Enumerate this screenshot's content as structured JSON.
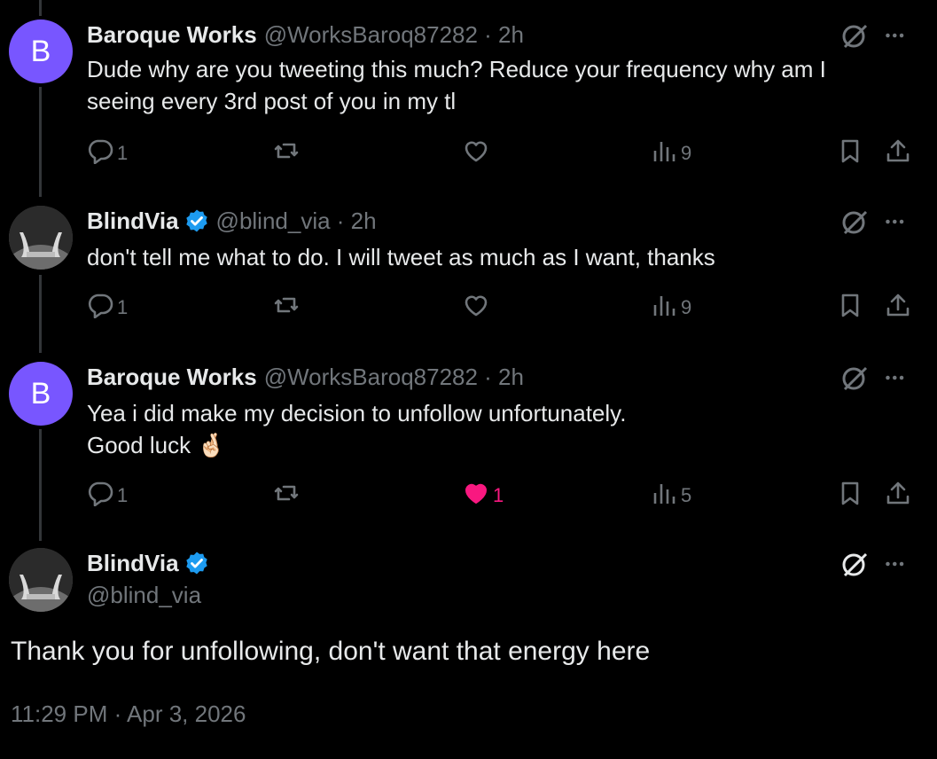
{
  "colors": {
    "background": "#000000",
    "text_primary": "#e7e9ea",
    "text_secondary": "#71767b",
    "verified_blue": "#1d9bf0",
    "like_pink": "#f91880",
    "avatar_purple": "#7856ff"
  },
  "tweets": [
    {
      "avatar_letter": "B",
      "name": "Baroque Works",
      "handle": "@WorksBaroq87282 · 2h",
      "verified": false,
      "lines": [
        "Dude why are you tweeting this much? Reduce your frequency why am I",
        "seeing every 3rd post of you in my tl"
      ],
      "reply_count": "1",
      "retweet_count": "",
      "like_count": "",
      "liked": false,
      "view_count": "9"
    },
    {
      "avatar_letter": "",
      "name": "BlindVia",
      "handle": "@blind_via · 2h",
      "verified": true,
      "lines": [
        "don't tell me what to do. I will tweet as much as I want, thanks"
      ],
      "reply_count": "1",
      "retweet_count": "",
      "like_count": "",
      "liked": false,
      "view_count": "9"
    },
    {
      "avatar_letter": "B",
      "name": "Baroque Works",
      "handle": "@WorksBaroq87282 · 2h",
      "verified": false,
      "lines": [
        "Yea i did make my decision to unfollow unfortunately.",
        "Good luck 🤞🏻"
      ],
      "reply_count": "1",
      "retweet_count": "",
      "like_count": "1",
      "liked": true,
      "view_count": "5"
    }
  ],
  "focus": {
    "name": "BlindVia",
    "handle": "@blind_via",
    "verified": true,
    "text": "Thank you for unfollowing, don't want that energy here",
    "timestamp": "11:29 PM · Apr 3, 2026"
  },
  "icons": {
    "reply": "reply-icon",
    "retweet": "retweet-icon",
    "like": "heart-icon",
    "views": "views-chart-icon",
    "bookmark": "bookmark-icon",
    "share": "share-icon",
    "grok": "grok-icon",
    "more": "more-dots-icon",
    "verified": "verified-badge-icon"
  }
}
